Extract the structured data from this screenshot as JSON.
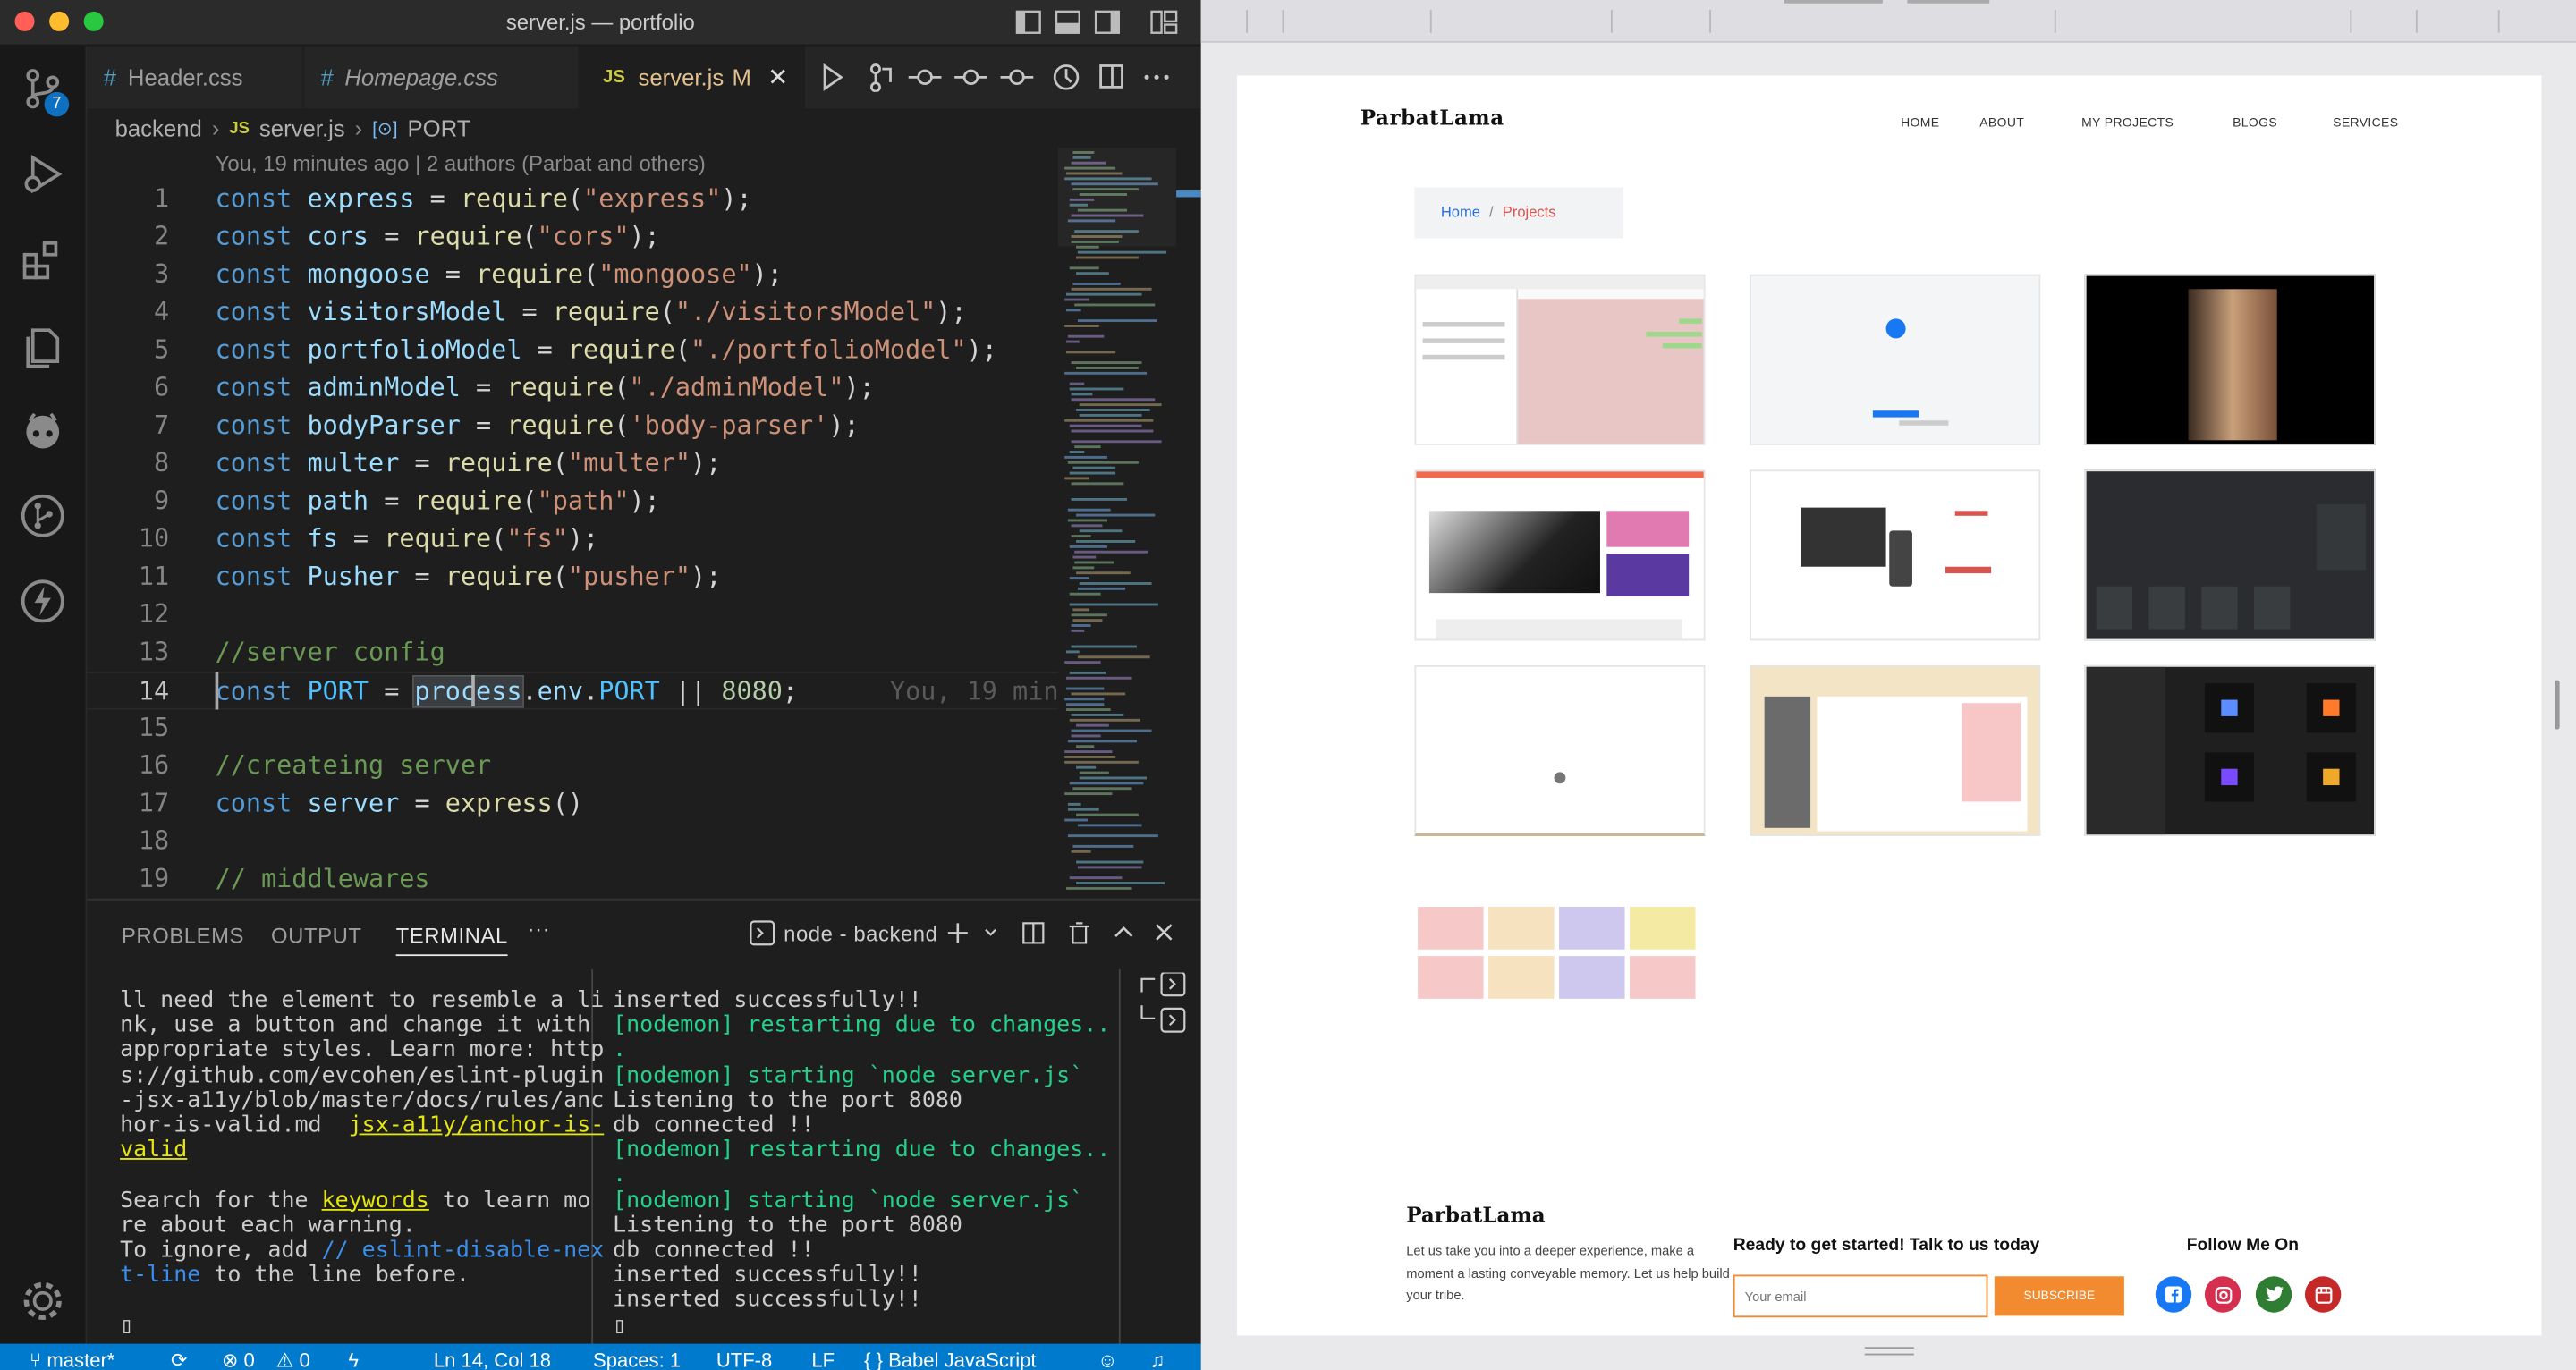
{
  "window": {
    "title": "server.js — portfolio"
  },
  "activity": {
    "source_control_badge": "7"
  },
  "tabs": [
    {
      "label": "Header.css",
      "icon": "#"
    },
    {
      "label": "Homepage.css",
      "icon": "#"
    },
    {
      "label": "server.js",
      "icon": "JS",
      "modified": "M"
    }
  ],
  "breadcrumb": {
    "folder": "backend",
    "file_icon": "JS",
    "file": "server.js",
    "symbol": "PORT"
  },
  "blame": "You, 19 minutes ago | 2 authors (Parbat and others)",
  "inline_blame": "You, 19 minu",
  "code": {
    "line_numbers": [
      "1",
      "2",
      "3",
      "4",
      "5",
      "6",
      "7",
      "8",
      "9",
      "10",
      "11",
      "12",
      "13",
      "14",
      "15",
      "16",
      "17",
      "18",
      "19"
    ],
    "l1": {
      "kw": "const",
      "name": "express",
      "eq": " = ",
      "fn": "require",
      "arg": "\"express\"",
      "end": ");"
    },
    "l2": {
      "kw": "const",
      "name": "cors",
      "eq": " = ",
      "fn": "require",
      "arg": "\"cors\"",
      "end": ");"
    },
    "l3": {
      "kw": "const",
      "name": "mongoose",
      "eq": " = ",
      "fn": "require",
      "arg": "\"mongoose\"",
      "end": ");"
    },
    "l4": {
      "kw": "const",
      "name": "visitorsModel",
      "eq": " = ",
      "fn": "require",
      "arg": "\"./visitorsModel\"",
      "end": ");"
    },
    "l5": {
      "kw": "const",
      "name": "portfolioModel",
      "eq": " = ",
      "fn": "require",
      "arg": "\"./portfolioModel\"",
      "end": ");"
    },
    "l6": {
      "kw": "const",
      "name": "adminModel",
      "eq": " = ",
      "fn": "require",
      "arg": "\"./adminModel\"",
      "end": ");"
    },
    "l7": {
      "kw": "const",
      "name": "bodyParser",
      "eq": " = ",
      "fn": "require",
      "arg": "'body-parser'",
      "end": ");"
    },
    "l8": {
      "kw": "const",
      "name": "multer",
      "eq": " = ",
      "fn": "require",
      "arg": "\"multer\"",
      "end": ");"
    },
    "l9": {
      "kw": "const",
      "name": "path",
      "eq": " = ",
      "fn": "require",
      "arg": "\"path\"",
      "end": ");"
    },
    "l10": {
      "kw": "const",
      "name": "fs",
      "eq": " = ",
      "fn": "require",
      "arg": "\"fs\"",
      "end": ");"
    },
    "l11": {
      "kw": "const",
      "name": "Pusher",
      "eq": " = ",
      "fn": "require",
      "arg": "\"pusher\"",
      "end": ");"
    },
    "l13": "//server config",
    "l14": {
      "kw": "const",
      "name": "PORT",
      "eq": " = ",
      "obj": "process",
      "dot1": ".",
      "env": "env",
      "dot2": ".",
      "prop": "PORT",
      "or": " || ",
      "num": "8080",
      "end": ";"
    },
    "l16": "//createing server",
    "l17": {
      "kw": "const",
      "name": "server",
      "eq": " = ",
      "fn": "express",
      "end": "()"
    },
    "l19": "// middlewares"
  },
  "panel": {
    "tabs": [
      "PROBLEMS",
      "OUTPUT",
      "TERMINAL"
    ],
    "more": "···",
    "terminal_name": "node - backend",
    "left_lines": {
      "a1": "ll need the element to resemble a li",
      "a2": "nk, use a button and change it with",
      "a3": "appropriate styles. Learn more: http",
      "a4": "s://github.com/evcohen/eslint-plugin",
      "a5": "-jsx-a11y/blob/master/docs/rules/anc",
      "a6": "hor-is-valid.md",
      "a6b": "jsx-a11y/anchor-is-",
      "a7": "valid",
      "a9a": "Search for the ",
      "a9b": "keywords",
      "a9c": " to learn mo",
      "a10": "re about each warning.",
      "a11a": "To ignore, add ",
      "a11b": "// eslint-disable-nex",
      "a12a": "t-line",
      "a12b": " to the line before.",
      "cursor": "▯"
    },
    "right_lines": {
      "r1": "inserted successfully!!",
      "r2": "[nodemon] restarting due to changes..",
      "r3": ".",
      "r4": "[nodemon] starting `node server.js`",
      "r5": "Listening to the port 8080",
      "r6": "db connected !!",
      "r7": "[nodemon] restarting due to changes..",
      "r8": ".",
      "r9": "[nodemon] starting `node server.js`",
      "r10": "Listening to the port 8080",
      "r11": "db connected !!",
      "r12": "inserted successfully!!",
      "r13": "inserted successfully!!",
      "cursor": "▯"
    }
  },
  "statusbar": {
    "branch": "master*",
    "errors": "⊗ 0",
    "warnings": "⚠ 0",
    "position": "Ln 14, Col 18",
    "spaces": "Spaces: 1",
    "encoding": "UTF-8",
    "eol": "LF",
    "language": "{ } Babel JavaScript"
  },
  "site": {
    "logo": "ParbatLama",
    "nav": [
      "HOME",
      "ABOUT",
      "MY PROJECTS",
      "BLOGS",
      "SERVICES"
    ],
    "breadcrumb_home": "Home",
    "breadcrumb_sep": "/",
    "breadcrumb_current": "Projects",
    "footer_logo": "ParbatLama",
    "footer_text": "Let us take you into a deeper experience, make a moment a lasting conveyable memory. Let us help build your tribe.",
    "cta_title": "Ready to get started! Talk to us today",
    "email_placeholder": "Your email",
    "subscribe": "SUBSCRIBE",
    "follow": "Follow Me On",
    "accent": "#f28a30",
    "link_blue": "#2a6fdb",
    "crumb_red": "#d9534f"
  }
}
